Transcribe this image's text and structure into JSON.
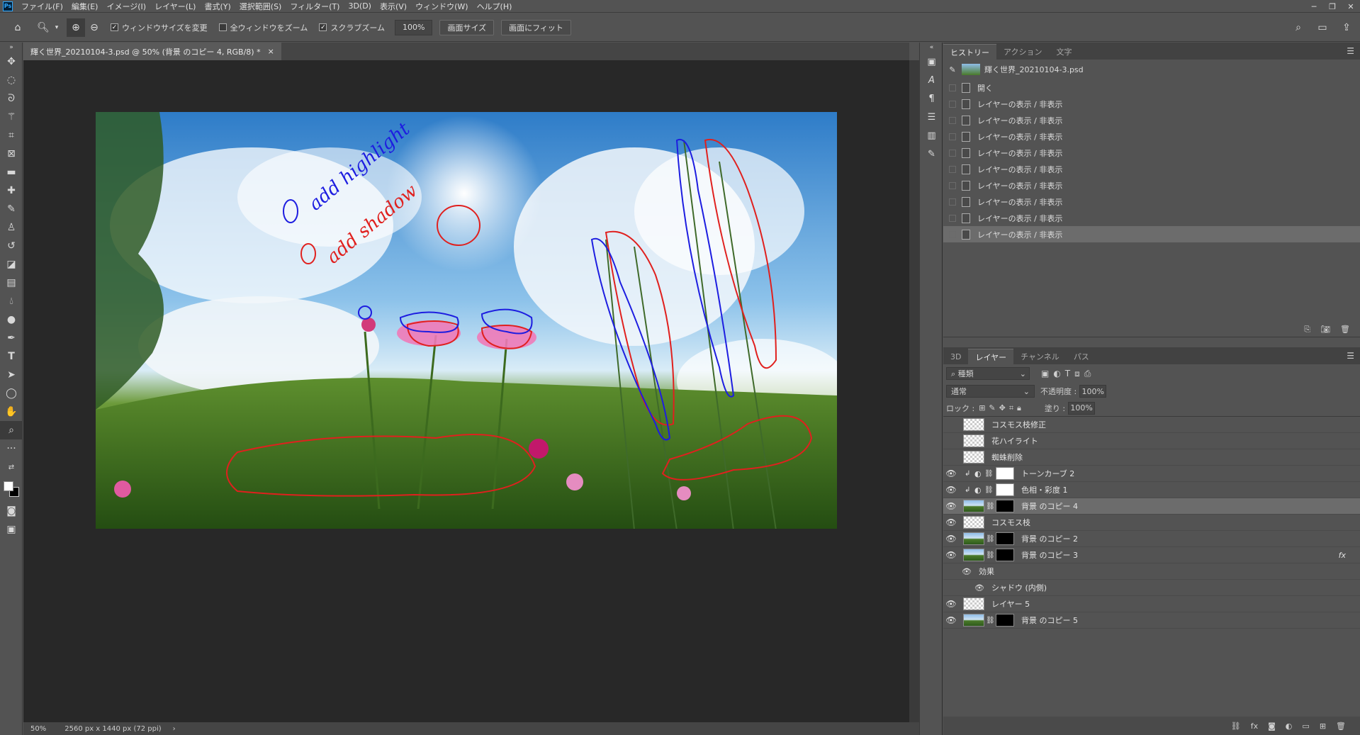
{
  "app": {
    "logo": "Ps"
  },
  "menu": [
    "ファイル(F)",
    "編集(E)",
    "イメージ(I)",
    "レイヤー(L)",
    "書式(Y)",
    "選択範囲(S)",
    "フィルター(T)",
    "3D(D)",
    "表示(V)",
    "ウィンドウ(W)",
    "ヘルプ(H)"
  ],
  "options": {
    "resize_windows": "ウィンドウサイズを変更",
    "zoom_all": "全ウィンドウをズーム",
    "scrubby_zoom": "スクラブズーム",
    "zoom_value": "100%",
    "screen_size": "画面サイズ",
    "fit_screen": "画面にフィット"
  },
  "document": {
    "tab_title": "輝く世界_20210104-3.psd @ 50% (背景 のコピー 4, RGB/8) *",
    "zoom": "50%",
    "dimensions": "2560 px x 1440 px (72 ppi)"
  },
  "annotations": {
    "note1": "add highlight",
    "note2": "add shadow"
  },
  "history": {
    "tabs": [
      "ヒストリー",
      "アクション",
      "文字"
    ],
    "snapshot": "輝く世界_20210104-3.psd",
    "items": [
      "開く",
      "レイヤーの表示 / 非表示",
      "レイヤーの表示 / 非表示",
      "レイヤーの表示 / 非表示",
      "レイヤーの表示 / 非表示",
      "レイヤーの表示 / 非表示",
      "レイヤーの表示 / 非表示",
      "レイヤーの表示 / 非表示",
      "レイヤーの表示 / 非表示",
      "レイヤーの表示 / 非表示"
    ],
    "selected_index": 9
  },
  "layers": {
    "tabs": [
      "3D",
      "レイヤー",
      "チャンネル",
      "パス"
    ],
    "filter_kind": "種類",
    "blend_mode": "通常",
    "opacity_label": "不透明度 :",
    "opacity": "100%",
    "lock_label": "ロック :",
    "fill_label": "塗り :",
    "fill": "100%",
    "effects_label": "効果",
    "effect_item": "シャドウ (内側)",
    "fx": "fx",
    "items": [
      {
        "name": "コスモス枝修正",
        "visible": false,
        "thumb": "trans"
      },
      {
        "name": "花ハイライト",
        "visible": false,
        "thumb": "trans"
      },
      {
        "name": "蜘蛛削除",
        "visible": false,
        "thumb": "trans"
      },
      {
        "name": "トーンカーブ 2",
        "visible": true,
        "thumb": "adjust"
      },
      {
        "name": "色相・彩度 1",
        "visible": true,
        "thumb": "adjust"
      },
      {
        "name": "背景 のコピー 4",
        "visible": true,
        "thumb": "photo-mask",
        "selected": true
      },
      {
        "name": "コスモス枝",
        "visible": true,
        "thumb": "trans"
      },
      {
        "name": "背景 のコピー 2",
        "visible": true,
        "thumb": "photo-mask"
      },
      {
        "name": "背景 のコピー 3",
        "visible": true,
        "thumb": "photo-mask"
      },
      {
        "name": "レイヤー 5",
        "visible": true,
        "thumb": "trans"
      },
      {
        "name": "背景 のコピー 5",
        "visible": true,
        "thumb": "photo-mask"
      }
    ]
  },
  "colors": {
    "accent": "#31a8ff",
    "ink_blue": "#1d1de0",
    "ink_red": "#e0201e"
  }
}
